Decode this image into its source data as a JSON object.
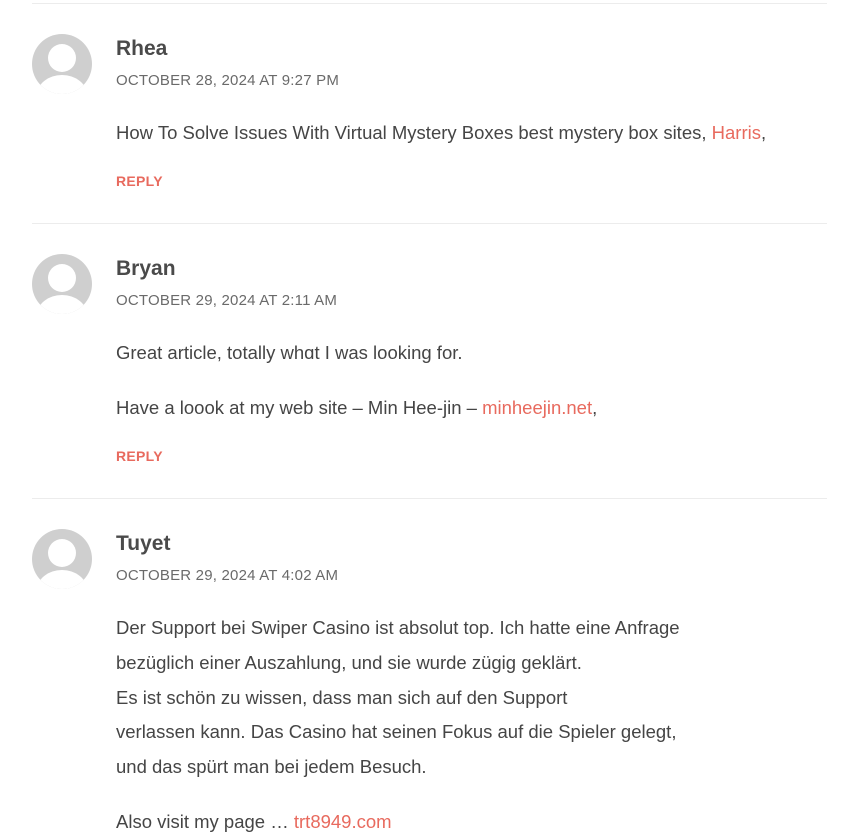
{
  "comments": [
    {
      "author": "Rhea",
      "date": "OCTOBER 28, 2024 AT 9:27 PM",
      "text": "How To Solve Issues With Virtual Mystery Boxes best mystery box sites,",
      "link": "Harris",
      "trailing": ",",
      "reply": "REPLY"
    },
    {
      "author": "Bryan",
      "date": "OCTOBER 29, 2024 AT 2:11 AM",
      "line1": "Great article, totally whɑt I was looking for.",
      "line2": "Have a loook at my web site – Min Hee-jin –",
      "link": "minheejin.net",
      "trailing": ",",
      "reply": "REPLY"
    },
    {
      "author": "Tuyet",
      "date": "OCTOBER 29, 2024 AT 4:02 AM",
      "lines": [
        "Der Support bei Swiper Casino ist absolut top. Ich hatte eine Anfrage",
        "bezüglich einer Auszahlung, und sie wurde zügig geklärt.",
        "Es ist schön zu wissen, dass man sich auf den Support",
        "verlassen kann. Das Casino hat seinen Fokus auf die Spieler gelegt,",
        "und das spürt man bei jedem Besuch."
      ],
      "also": "Also visit my page …",
      "link": "trt8949.com"
    }
  ]
}
